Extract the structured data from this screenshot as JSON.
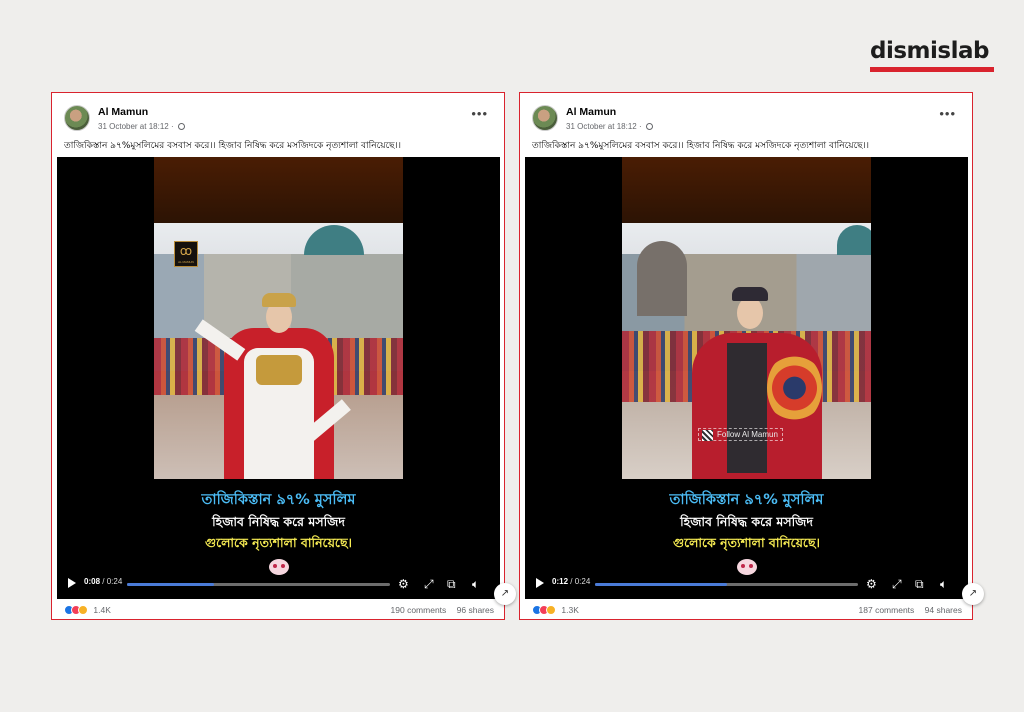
{
  "brand": {
    "name": "dismislab",
    "accent_color": "#d9232e"
  },
  "posts": [
    {
      "author": "Al Mamun",
      "timestamp": "31 October at 18:12",
      "audience_icon": "globe-icon",
      "caption": "তাজিকিস্তান ৯৭%মুসলিমের বসবাস করে।। হিজাব নিষিদ্ধ করে মসজিদকে নৃত্যশালা বানিয়েছে।।",
      "video": {
        "overlay_line1": "তাজিকিস্তান ৯৭% মুসলিম",
        "overlay_line2": "হিজাব নিষিদ্ধ করে মসজিদ",
        "overlay_line3": "গুলোকে নৃত্যশালা বানিয়েছে।",
        "watermark": "AL MAMUN",
        "follow_tag": "",
        "current_time": "0:08",
        "total_time": "0:24",
        "progress": 0.33
      },
      "reactions_count": "1.4K",
      "comments": "190 comments",
      "shares": "96 shares"
    },
    {
      "author": "Al Mamun",
      "timestamp": "31 October at 18:12",
      "audience_icon": "globe-icon",
      "caption": "তাজিকিস্তান ৯৭%মুসলিমের বসবাস করে।। হিজাব নিষিদ্ধ করে মসজিদকে নৃত্যশালা বানিয়েছে।।",
      "video": {
        "overlay_line1": "তাজিকিস্তান ৯৭% মুসলিম",
        "overlay_line2": "হিজাব নিষিদ্ধ করে মসজিদ",
        "overlay_line3": "গুলোকে নৃত্যশালা বানিয়েছে।",
        "watermark": "",
        "follow_tag": "Follow Al Mamun",
        "current_time": "0:12",
        "total_time": "0:24",
        "progress": 0.5
      },
      "reactions_count": "1.3K",
      "comments": "187 comments",
      "shares": "94 shares"
    }
  ],
  "controls": {
    "separator": "/"
  }
}
